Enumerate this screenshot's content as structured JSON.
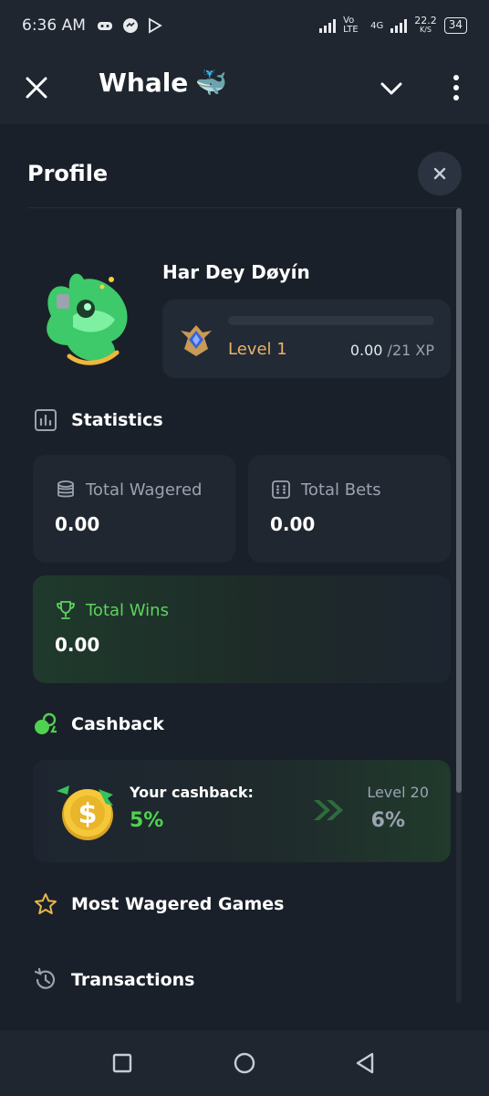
{
  "status_bar": {
    "time": "6:36 AM",
    "network_1": "Vo LTE",
    "network_2": "4G",
    "speed": "22.2",
    "speed_unit": "K/S",
    "battery": "34"
  },
  "app_bar": {
    "title": "Whale",
    "title_emoji": "🐳",
    "close_icon": "close-icon",
    "menu_icon": "chevron-down-icon",
    "more_icon": "more-vertical-icon"
  },
  "profile": {
    "heading": "Profile",
    "username": "Har Dey Døyín",
    "level_label": "Level 1",
    "xp_current": "0.00",
    "xp_max": "/21 XP",
    "xp_progress": 0
  },
  "statistics": {
    "heading": "Statistics",
    "total_wagered_label": "Total Wagered",
    "total_wagered_value": "0.00",
    "total_bets_label": "Total Bets",
    "total_bets_value": "0.00",
    "total_wins_label": "Total Wins",
    "total_wins_value": "0.00"
  },
  "cashback": {
    "heading": "Cashback",
    "your_label": "Your cashback:",
    "your_value": "5%",
    "next_level_label": "Level 20",
    "next_level_value": "6%"
  },
  "sections": {
    "most_wagered": "Most Wagered Games",
    "transactions": "Transactions"
  },
  "colors": {
    "accent_green": "#4fd24f",
    "level_gold": "#e8b36a",
    "background": "#1a2029"
  }
}
